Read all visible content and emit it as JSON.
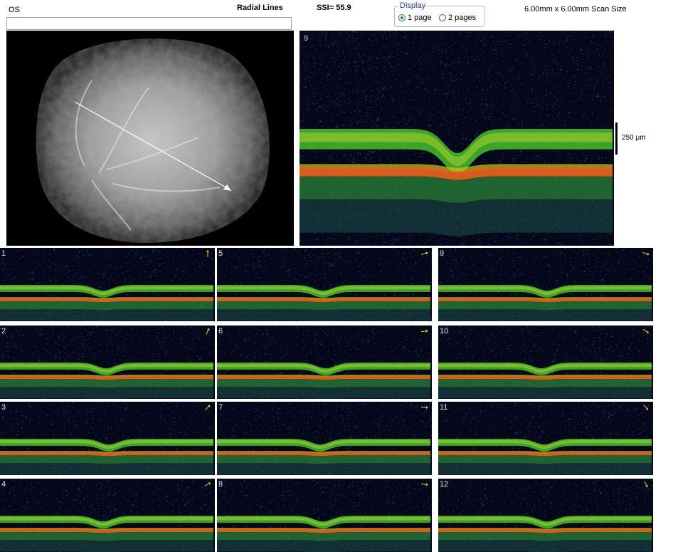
{
  "header": {
    "eye": "OS",
    "protocol": "Radial Lines",
    "ssi": "SSI= 55.9",
    "scan_size": "6.00mm x 6.00mm Scan Size"
  },
  "display": {
    "legend": "Display",
    "options": [
      {
        "label": "1 page",
        "selected": true
      },
      {
        "label": "2 pages",
        "selected": false
      }
    ]
  },
  "main_scan": {
    "number": "9",
    "scale_label": "250 μm"
  },
  "thumbnails": [
    {
      "number": "1",
      "arrow": "up"
    },
    {
      "number": "2",
      "arrow": "up-right-steep"
    },
    {
      "number": "3",
      "arrow": "up-right"
    },
    {
      "number": "4",
      "arrow": "up-right-shallow"
    },
    {
      "number": "5",
      "arrow": "right-up"
    },
    {
      "number": "6",
      "arrow": "right-up-slight"
    },
    {
      "number": "7",
      "arrow": "right"
    },
    {
      "number": "8",
      "arrow": "right-down-slight"
    },
    {
      "number": "9",
      "arrow": "right-down"
    },
    {
      "number": "10",
      "arrow": "down-right"
    },
    {
      "number": "11",
      "arrow": "down-right-steep"
    },
    {
      "number": "12",
      "arrow": "down"
    }
  ],
  "colors": {
    "scan_background": "#05081a",
    "retina_green": "#3fae2a",
    "rpe_orange": "#e2601c",
    "arrow_yellow": "#e8c81a"
  }
}
